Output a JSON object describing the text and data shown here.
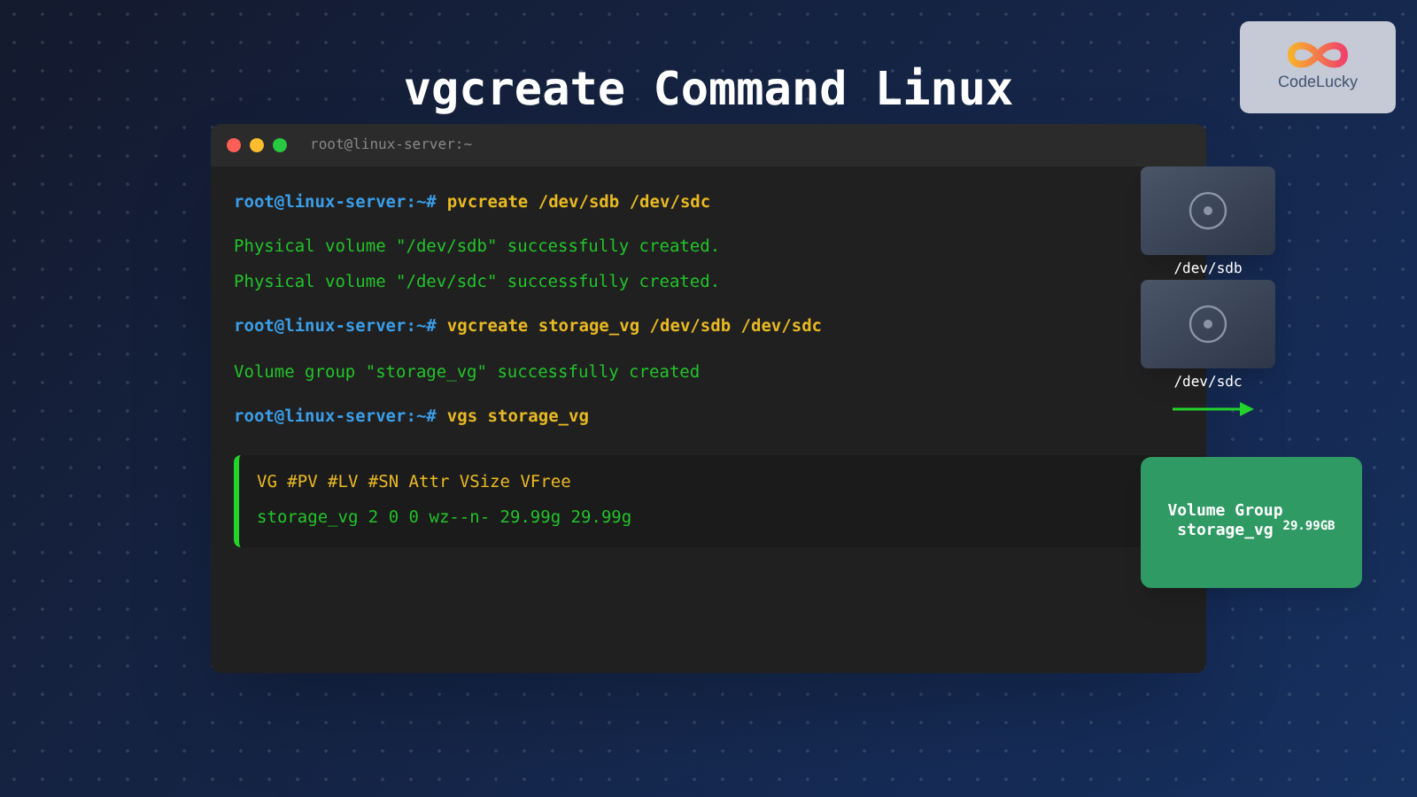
{
  "title": "vgcreate Command Linux",
  "logo": {
    "text": "CodeLucky"
  },
  "terminal": {
    "title": "root@linux-server:~",
    "lines": [
      {
        "kind": "command",
        "prompt": "root@linux-server:~#",
        "command": "pvcreate /dev/sdb /dev/sdc"
      },
      {
        "kind": "output",
        "text": "Physical volume \"/dev/sdb\" successfully created."
      },
      {
        "kind": "output",
        "text": "Physical volume \"/dev/sdc\" successfully created."
      },
      {
        "kind": "command",
        "prompt": "root@linux-server:~#",
        "command": "vgcreate storage_vg /dev/sdb /dev/sdc"
      },
      {
        "kind": "output",
        "text": "Volume group \"storage_vg\" successfully created"
      },
      {
        "kind": "command",
        "prompt": "root@linux-server:~#",
        "command": "vgs storage_vg"
      },
      {
        "kind": "table",
        "header": "VG #PV #LV #SN Attr VSize VFree",
        "row": "storage_vg 2 0 0 wz--n- 29.99g 29.99g"
      }
    ]
  },
  "disks": [
    {
      "label": "/dev/sdb"
    },
    {
      "label": "/dev/sdc"
    }
  ],
  "volume_group": {
    "name": "Volume Group",
    "vg": "storage_vg",
    "size": "29.99GB"
  }
}
